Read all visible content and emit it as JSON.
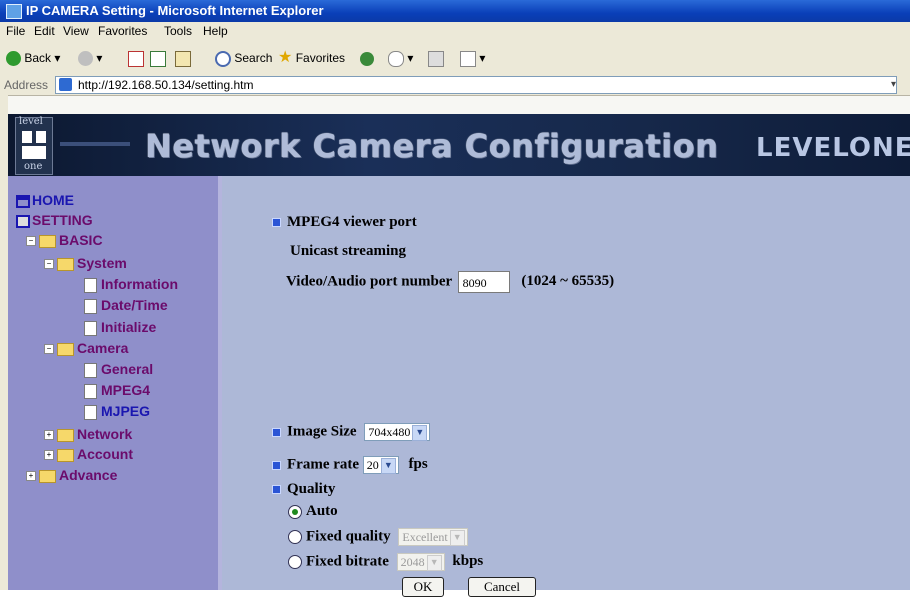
{
  "window": {
    "title": "IP CAMERA Setting - Microsoft Internet Explorer"
  },
  "menu": [
    "File",
    "Edit",
    "View",
    "Favorites",
    "Tools",
    "Help"
  ],
  "toolbar": {
    "back": "Back",
    "search": "Search",
    "favorites": "Favorites"
  },
  "address": {
    "label": "Address",
    "url": "http://192.168.50.134/setting.htm"
  },
  "banner": {
    "title": "Network Camera Configuration",
    "brand": "LEVELONE",
    "logo_top": "level",
    "logo_bottom": "one"
  },
  "tree": {
    "home": "HOME",
    "setting": "SETTING",
    "basic": "BASIC",
    "system": "System",
    "information": "Information",
    "datetime": "Date/Time",
    "initialize": "Initialize",
    "camera": "Camera",
    "general": "General",
    "mpeg4": "MPEG4",
    "mjpeg": "MJPEG",
    "network": "Network",
    "account": "Account",
    "advance": "Advance"
  },
  "form": {
    "viewer_port_heading": "MPEG4 viewer port",
    "unicast_label": "Unicast streaming",
    "port_label": "Video/Audio port number",
    "port_value": "8090",
    "port_range": "(1024 ~ 65535)",
    "image_size_label": "Image Size",
    "image_size_value": "704x480",
    "frame_rate_label": "Frame rate",
    "frame_rate_value": "20",
    "frame_rate_unit": "fps",
    "quality_label": "Quality",
    "auto_label": "Auto",
    "fixed_quality_label": "Fixed quality",
    "fixed_quality_value": "Excellent",
    "fixed_bitrate_label": "Fixed bitrate",
    "fixed_bitrate_value": "2048",
    "bitrate_unit": "kbps",
    "ok_label": "OK",
    "cancel_label": "Cancel",
    "quality_selected": "Auto"
  },
  "colors": {
    "sidebar_bg": "#8f8fca",
    "main_bg": "#adb8d7",
    "tree_text": "#6b0b6b",
    "selected_text": "#1a16b0"
  }
}
